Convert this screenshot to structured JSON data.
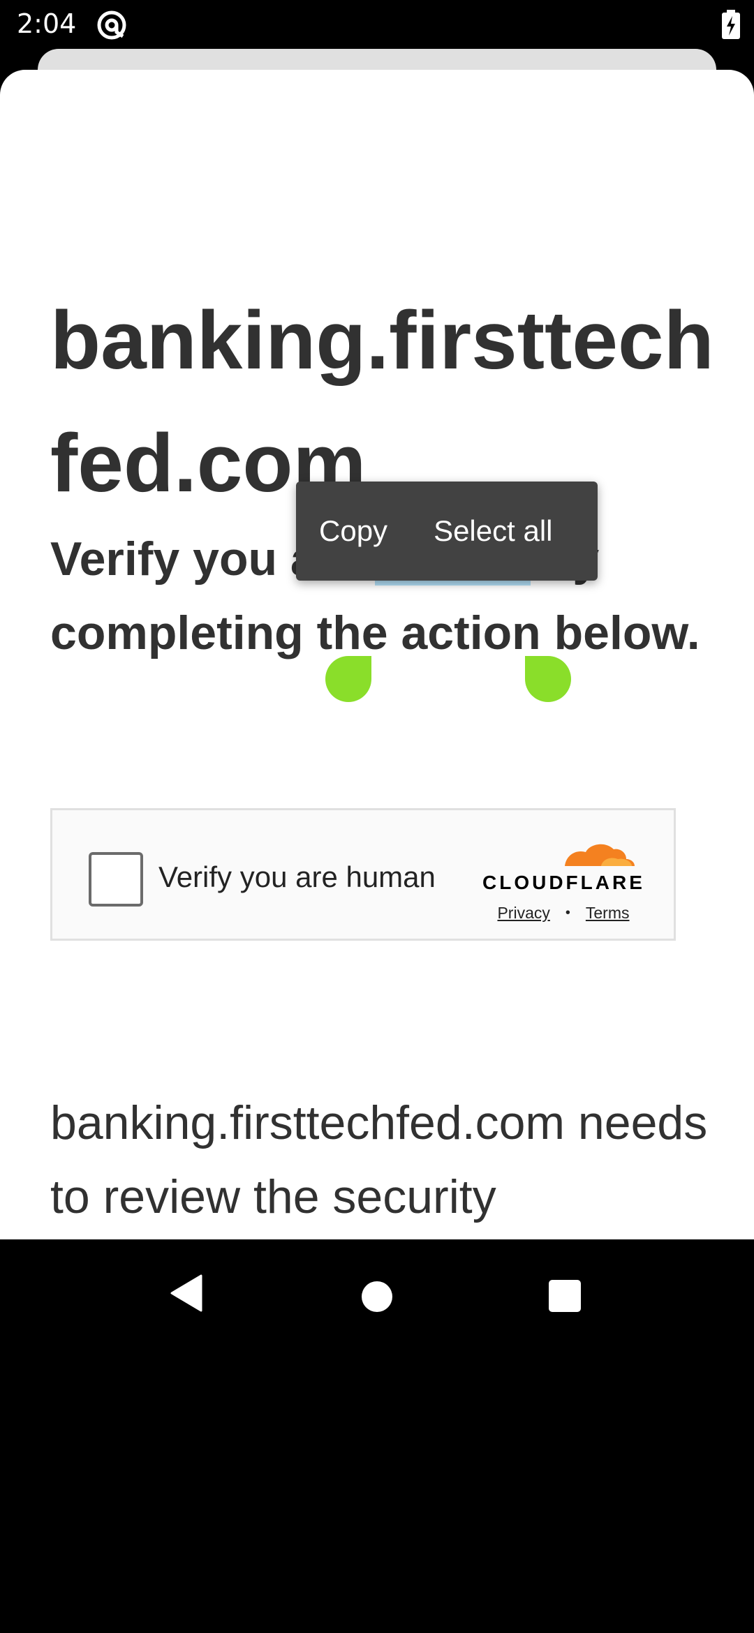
{
  "status_bar": {
    "time": "2:04",
    "app_icon": "at-sign-icon",
    "battery_icon": "battery-charging-icon"
  },
  "page": {
    "site_title": "banking.firsttechfed.com",
    "verify_heading": {
      "before": "Verify you are ",
      "selected": "human",
      "after": " by completing the action below."
    },
    "body_text": "banking.firsttechfed.com needs to review the security"
  },
  "context_menu": {
    "copy_label": "Copy",
    "select_all_label": "Select all"
  },
  "turnstile": {
    "checkbox_label": "Verify you are human",
    "brand": "CLOUDFLARE",
    "privacy_label": "Privacy",
    "separator": "•",
    "terms_label": "Terms",
    "checked": false
  },
  "colors": {
    "selection_highlight": "#b3e0f8",
    "selection_handle": "#8ade2a",
    "cloudflare_orange": "#f48120"
  },
  "nav_bar": {
    "back_icon": "back-triangle-icon",
    "home_icon": "home-circle-icon",
    "recents_icon": "recents-square-icon"
  }
}
